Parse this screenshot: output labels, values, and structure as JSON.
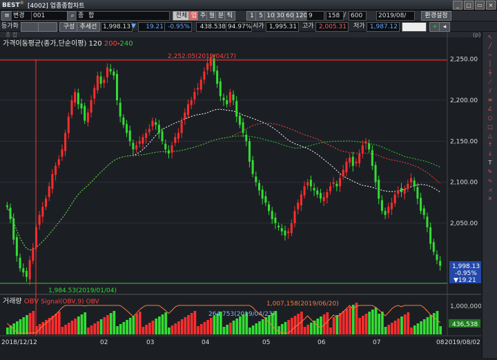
{
  "app": {
    "logo": "BEST",
    "window_title": "[4002] 업종종합차트"
  },
  "toolbar1": {
    "market_select": "변경",
    "code": "001",
    "name": "종 합",
    "buttons": [
      "전체",
      "업",
      "주",
      "월",
      "분",
      "틱"
    ],
    "intervals": [
      "1",
      "5",
      "10",
      "30",
      "60",
      "120"
    ],
    "count_a": "9",
    "count_b": "158",
    "count_c": "600",
    "date": "2019/08/",
    "env_button": "환경설정"
  },
  "toolbar2": {
    "left_label": "등가화",
    "compose": "구성",
    "trend": "추세선",
    "price": "1,998.13",
    "arrow": "▼",
    "change": "19.21",
    "change_pct": "-0.95%",
    "volume": "438.538",
    "ratio": "94.97%",
    "open_label": "시가",
    "open": "1,995.31",
    "high_label": "고가",
    "high": "2,005.31",
    "low_label": "저가",
    "low": "1,987.12"
  },
  "chart_header": {
    "left": "종 합",
    "right_unit": "(p)"
  },
  "price_panel": {
    "legend": "가격이동평균(종가,단순이평) 120",
    "legend_red": "200",
    "legend_green": "240",
    "high_annotation": "2,252.05(2019/04/17)",
    "low_annotation": "1,984.53(2019/01/04)",
    "current_label": {
      "price": "1,998.13",
      "pct": "-0.95%",
      "change": "▼19.21"
    }
  },
  "volume_panel": {
    "legend": "거래량",
    "legend2": "OBV",
    "legend3": "Signal(OBV,9) OBV",
    "annotation_top": "1,007,158(2019/06/20)",
    "annotation_left": "264,753(2019/04/23)",
    "current_label": "436,538",
    "y_tick": "1,000,000"
  },
  "x_axis": {
    "start_label": "2018/12/12",
    "months": [
      "02",
      "03",
      "04",
      "05",
      "06",
      "07",
      "08"
    ],
    "end_label": "2019/08/02"
  },
  "colors": {
    "up": "#ff2d2d",
    "down": "#33dd33",
    "ma120": "#ffffff",
    "ma200": "#ff4040",
    "ma240": "#33cc33",
    "bg": "#1b1f24"
  },
  "chart_data": {
    "type": "candlestick",
    "y_axis": {
      "ticks": [
        "2,250.00",
        "2,200.00",
        "2,150.00",
        "2,100.00",
        "2,050.00"
      ],
      "range": [
        1970,
        2275
      ]
    },
    "closes": [
      2070,
      2055,
      2030,
      2010,
      1995,
      1990,
      1984.53,
      2005,
      2020,
      2045,
      2060,
      2070,
      2080,
      2095,
      2110,
      2120,
      2128,
      2140,
      2160,
      2180,
      2200,
      2210,
      2195,
      2190,
      2175,
      2185,
      2200,
      2215,
      2230,
      2220,
      2225,
      2240,
      2235,
      2230,
      2200,
      2180,
      2170,
      2160,
      2150,
      2140,
      2145,
      2150,
      2155,
      2160,
      2165,
      2175,
      2170,
      2160,
      2150,
      2140,
      2135,
      2145,
      2155,
      2160,
      2175,
      2185,
      2195,
      2200,
      2210,
      2215,
      2225,
      2235,
      2245,
      2252.05,
      2235,
      2220,
      2205,
      2200,
      2195,
      2210,
      2200,
      2180,
      2170,
      2160,
      2150,
      2125,
      2110,
      2100,
      2090,
      2080,
      2075,
      2065,
      2055,
      2050,
      2045,
      2040,
      2035,
      2040,
      2050,
      2065,
      2075,
      2085,
      2095,
      2100,
      2095,
      2090,
      2085,
      2080,
      2082,
      2088,
      2095,
      2100,
      2095,
      2105,
      2115,
      2125,
      2130,
      2120,
      2125,
      2135,
      2145,
      2150,
      2140,
      2120,
      2100,
      2080,
      2065,
      2060,
      2070,
      2075,
      2085,
      2090,
      2088,
      2092,
      2098,
      2105,
      2095,
      2080,
      2065,
      2060,
      2045,
      2025,
      2015,
      2005,
      1998.13
    ],
    "volume_note": "volume bars follow candle colors"
  }
}
